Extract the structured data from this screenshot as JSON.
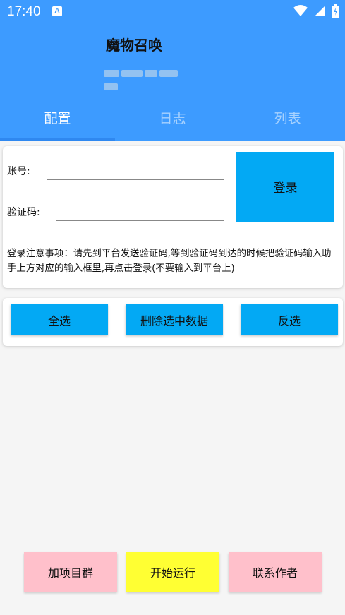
{
  "status_bar": {
    "time": "17:40",
    "notification_badge": "A"
  },
  "header": {
    "title": "魔物召唤",
    "subtitle_obscured": ""
  },
  "tabs": [
    {
      "label": "配置",
      "active": true
    },
    {
      "label": "日志",
      "active": false
    },
    {
      "label": "列表",
      "active": false
    }
  ],
  "login_card": {
    "account_label": "账号:",
    "account_value": "",
    "code_label": "验证码:",
    "code_value": "",
    "login_button": "登录",
    "note": "登录注意事项：请先到平台发送验证码,等到验证码到达的时候把验证码输入助手上方对应的输入框里,再点击登录(不要输入到平台上)"
  },
  "actions": {
    "select_all": "全选",
    "delete_selected": "删除选中数据",
    "invert_selection": "反选"
  },
  "bottom": {
    "join_group": "加项目群",
    "start_run": "开始运行",
    "contact_author": "联系作者"
  },
  "colors": {
    "header_bg": "#3d9bff",
    "button_blue": "#03a9f4",
    "join_group_bg": "#ffc0cb",
    "start_run_bg": "#ffff33",
    "contact_author_bg": "#ffc0cb"
  },
  "icons": [
    "wifi-icon",
    "signal-icon",
    "battery-icon"
  ]
}
